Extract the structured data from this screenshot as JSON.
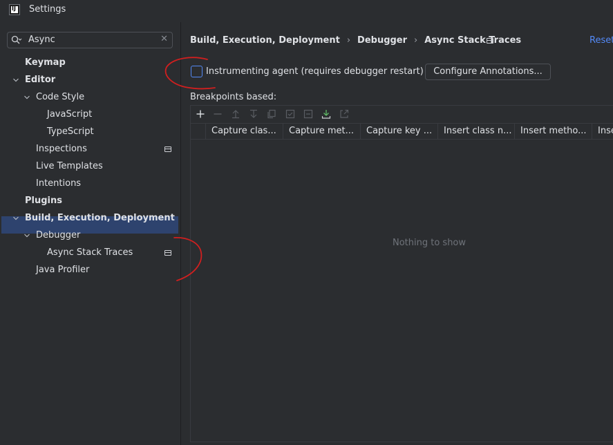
{
  "window": {
    "title": "Settings"
  },
  "search": {
    "value": "Async",
    "icon": "search-icon"
  },
  "tree": [
    {
      "label": "Keymap",
      "bold": true
    },
    {
      "label": "Editor",
      "bold": true,
      "expanded": true
    },
    {
      "label": "Code Style",
      "expanded": true
    },
    {
      "label": "JavaScript"
    },
    {
      "label": "TypeScript"
    },
    {
      "label": "Inspections",
      "project_icon": true
    },
    {
      "label": "Live Templates"
    },
    {
      "label": "Intentions"
    },
    {
      "label": "Plugins",
      "bold": true
    },
    {
      "label": "Build, Execution, Deployment",
      "bold": true,
      "expanded": true
    },
    {
      "label": "Debugger",
      "expanded": true
    },
    {
      "label": "Async Stack Traces",
      "selected": true,
      "project_icon": true
    },
    {
      "label": "Java Profiler"
    }
  ],
  "breadcrumb": [
    "Build, Execution, Deployment",
    "Debugger",
    "Async Stack Traces"
  ],
  "reset_label": "Reset",
  "instrumenting": {
    "label": "Instrumenting agent (requires debugger restart)",
    "checked": false
  },
  "configure_button": "Configure Annotations...",
  "breakpoints_label": "Breakpoints based:",
  "toolbar_icons": [
    "add-icon",
    "remove-icon",
    "move-up-icon",
    "move-down-icon",
    "copy-icon",
    "check-all-icon",
    "uncheck-all-icon",
    "import-icon",
    "export-icon"
  ],
  "columns": [
    "Capture clas...",
    "Capture met...",
    "Capture key ...",
    "Insert class n...",
    "Insert metho...",
    "Inse"
  ],
  "empty_text": "Nothing to show",
  "colors": {
    "accent": "#548af7",
    "selection": "#2e436e",
    "annotation": "#d11f1f"
  }
}
